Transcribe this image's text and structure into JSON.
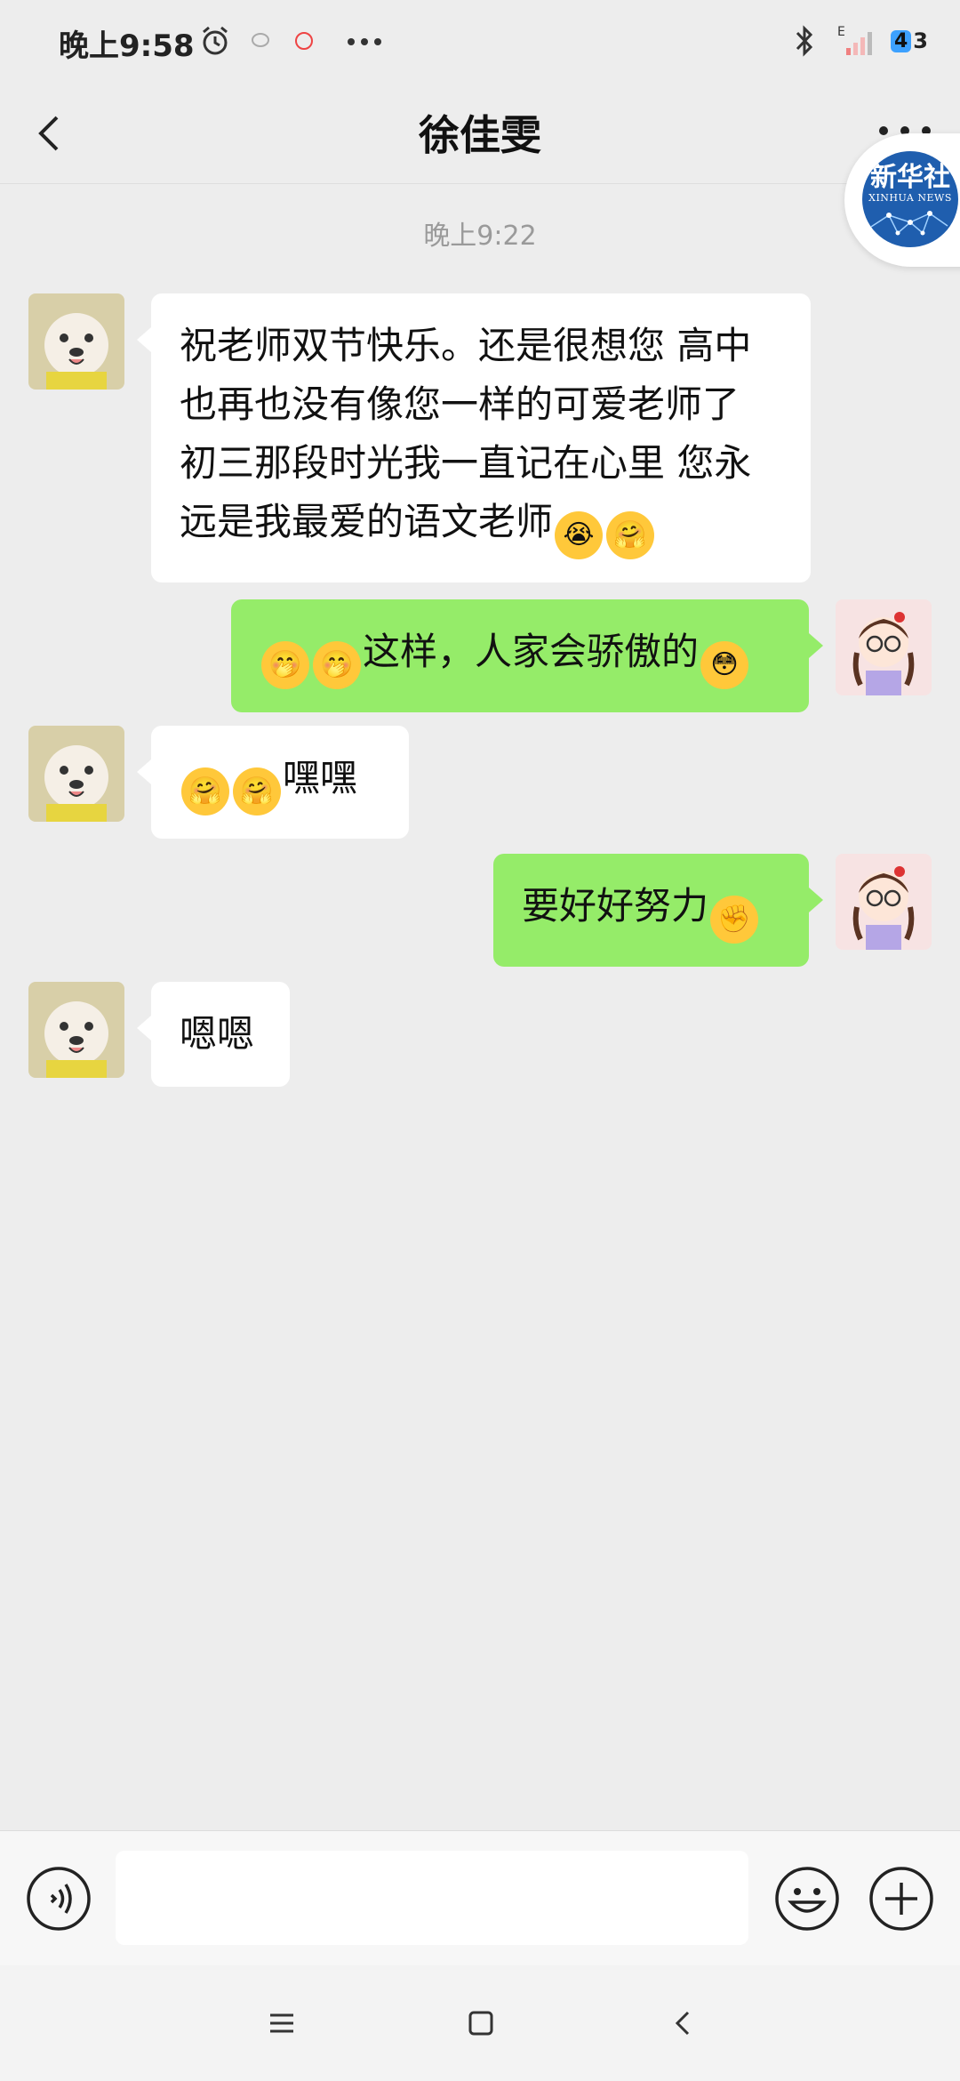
{
  "status_bar": {
    "time": "晚上9:58",
    "network": "E",
    "battery": "43"
  },
  "header": {
    "title": "徐佳雯",
    "badge_cn": "新华社",
    "badge_en": "XINHUA NEWS"
  },
  "chat": {
    "timestamp": "晚上9:22",
    "messages": [
      {
        "side": "in",
        "text": "祝老师双节快乐。还是很想您 高中也再也没有像您一样的可爱老师了 初三那段时光我一直记在心里 您永远是我最爱的语文老师"
      },
      {
        "side": "out",
        "text": "这样，人家会骄傲的"
      },
      {
        "side": "in",
        "text": "嘿嘿"
      },
      {
        "side": "out",
        "text": "要好好努力"
      },
      {
        "side": "in",
        "text": "嗯嗯"
      }
    ]
  },
  "input": {
    "placeholder": ""
  },
  "colors": {
    "background": "#ededed",
    "incoming_bubble": "#ffffff",
    "outgoing_bubble": "#95ec69"
  },
  "icons": [
    "alarm-icon",
    "bluetooth-icon",
    "signal-icon",
    "back-icon",
    "more-icon",
    "voice-icon",
    "emoji-icon",
    "plus-icon",
    "menu-icon",
    "home-icon",
    "nav-back-icon"
  ]
}
